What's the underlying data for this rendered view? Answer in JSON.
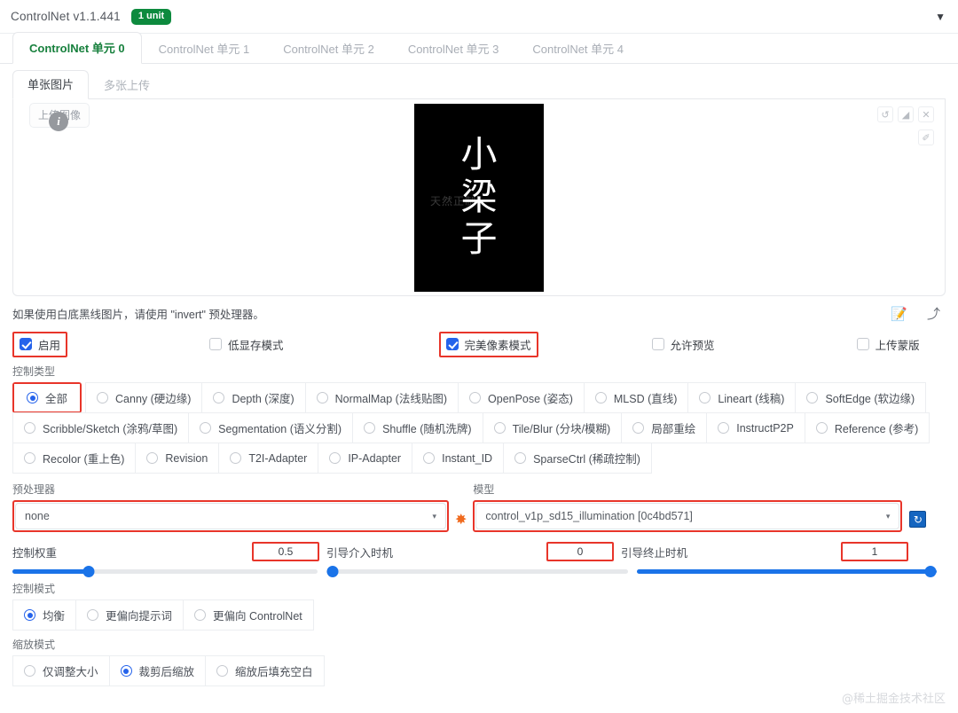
{
  "header": {
    "title": "ControlNet v1.1.441",
    "badge": "1 unit",
    "caret": "▼"
  },
  "unit_tabs": [
    {
      "label": "ControlNet 单元 0",
      "active": true
    },
    {
      "label": "ControlNet 单元 1",
      "active": false
    },
    {
      "label": "ControlNet 单元 2",
      "active": false
    },
    {
      "label": "ControlNet 单元 3",
      "active": false
    },
    {
      "label": "ControlNet 单元 4",
      "active": false
    }
  ],
  "sub_tabs": [
    {
      "label": "单张图片",
      "active": true
    },
    {
      "label": "多张上传",
      "active": false
    }
  ],
  "image_area": {
    "chip_label": "上传图像",
    "cursor_glyph": "i",
    "preview_chars": [
      "小",
      "梁",
      "子"
    ],
    "preview_watermark": "天然正制",
    "tools": [
      {
        "name": "undo-icon",
        "glyph": "↺"
      },
      {
        "name": "eraser-icon",
        "glyph": "◢"
      },
      {
        "name": "close-icon",
        "glyph": "✕"
      }
    ],
    "pen_glyph": "✐"
  },
  "hint": {
    "text": "如果使用白底黑线图片，请使用 \"invert\" 预处理器。",
    "icons": [
      {
        "name": "edit-note-icon",
        "glyph": "📝"
      },
      {
        "name": "arrow-return-icon",
        "glyph": "⤴"
      }
    ]
  },
  "checkboxes": [
    {
      "label": "启用",
      "checked": true,
      "highlight": true
    },
    {
      "label": "低显存模式",
      "checked": false,
      "highlight": false
    },
    {
      "label": "完美像素模式",
      "checked": true,
      "highlight": true
    },
    {
      "label": "允许预览",
      "checked": false,
      "highlight": false
    },
    {
      "label": "上传蒙版",
      "checked": false,
      "highlight": false
    }
  ],
  "control_type": {
    "label": "控制类型",
    "rows": [
      [
        {
          "label": "全部",
          "selected": true,
          "highlight": true
        },
        {
          "label": "Canny (硬边缘)",
          "selected": false,
          "highlight": false
        },
        {
          "label": "Depth (深度)",
          "selected": false,
          "highlight": false
        },
        {
          "label": "NormalMap (法线贴图)",
          "selected": false,
          "highlight": false
        },
        {
          "label": "OpenPose (姿态)",
          "selected": false,
          "highlight": false
        },
        {
          "label": "MLSD (直线)",
          "selected": false,
          "highlight": false
        },
        {
          "label": "Lineart (线稿)",
          "selected": false,
          "highlight": false
        },
        {
          "label": "SoftEdge (软边缘)",
          "selected": false,
          "highlight": false
        }
      ],
      [
        {
          "label": "Scribble/Sketch (涂鸦/草图)",
          "selected": false,
          "highlight": false
        },
        {
          "label": "Segmentation (语义分割)",
          "selected": false,
          "highlight": false
        },
        {
          "label": "Shuffle (随机洗牌)",
          "selected": false,
          "highlight": false
        },
        {
          "label": "Tile/Blur (分块/模糊)",
          "selected": false,
          "highlight": false
        },
        {
          "label": "局部重绘",
          "selected": false,
          "highlight": false
        },
        {
          "label": "InstructP2P",
          "selected": false,
          "highlight": false
        },
        {
          "label": "Reference (参考)",
          "selected": false,
          "highlight": false
        }
      ],
      [
        {
          "label": "Recolor (重上色)",
          "selected": false,
          "highlight": false
        },
        {
          "label": "Revision",
          "selected": false,
          "highlight": false
        },
        {
          "label": "T2I-Adapter",
          "selected": false,
          "highlight": false
        },
        {
          "label": "IP-Adapter",
          "selected": false,
          "highlight": false
        },
        {
          "label": "Instant_ID",
          "selected": false,
          "highlight": false
        },
        {
          "label": "SparseCtrl (稀疏控制)",
          "selected": false,
          "highlight": false
        }
      ]
    ]
  },
  "preprocessor": {
    "label": "预处理器",
    "value": "none",
    "caret": "▾",
    "explode_icon": "✸"
  },
  "model": {
    "label": "模型",
    "value": "control_v1p_sd15_illumination [0c4bd571]",
    "caret": "▾",
    "refresh_icon": "↻"
  },
  "sliders": [
    {
      "label": "控制权重",
      "value": "0.5",
      "pct": 25
    },
    {
      "label": "引导介入时机",
      "value": "0",
      "pct": 0
    },
    {
      "label": "引导终止时机",
      "value": "1",
      "pct": 100
    }
  ],
  "control_mode": {
    "label": "控制模式",
    "options": [
      {
        "label": "均衡",
        "selected": true
      },
      {
        "label": "更偏向提示词",
        "selected": false
      },
      {
        "label": "更偏向 ControlNet",
        "selected": false
      }
    ]
  },
  "resize_mode": {
    "label": "缩放模式",
    "options": [
      {
        "label": "仅调整大小",
        "selected": false
      },
      {
        "label": "裁剪后缩放",
        "selected": true
      },
      {
        "label": "缩放后填充空白",
        "selected": false
      }
    ]
  },
  "watermark": "@稀土掘金技术社区",
  "colors": {
    "accent_green": "#17803d",
    "highlight_red": "#e8352a",
    "slider_blue": "#1a73e8",
    "checkbox_blue": "#2563eb"
  }
}
